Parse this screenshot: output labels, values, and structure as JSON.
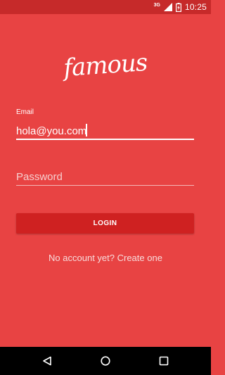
{
  "status_bar": {
    "network_type": "3G",
    "time": "10:25",
    "signal_icon": "signal-icon",
    "battery_icon": "battery-charging-icon"
  },
  "app": {
    "logo_text": "famous"
  },
  "form": {
    "email_label": "Email",
    "email_value": "hola@you.com",
    "password_placeholder": "Password",
    "password_value": "",
    "login_label": "LOGIN",
    "create_account_text": "No account yet? Create one"
  },
  "nav_bar": {
    "back_icon": "back-icon",
    "home_icon": "home-icon",
    "recents_icon": "recents-icon"
  },
  "colors": {
    "background": "#e84343",
    "status_bar": "#c62a2a",
    "button": "#cf2121",
    "nav_bar": "#000000"
  }
}
